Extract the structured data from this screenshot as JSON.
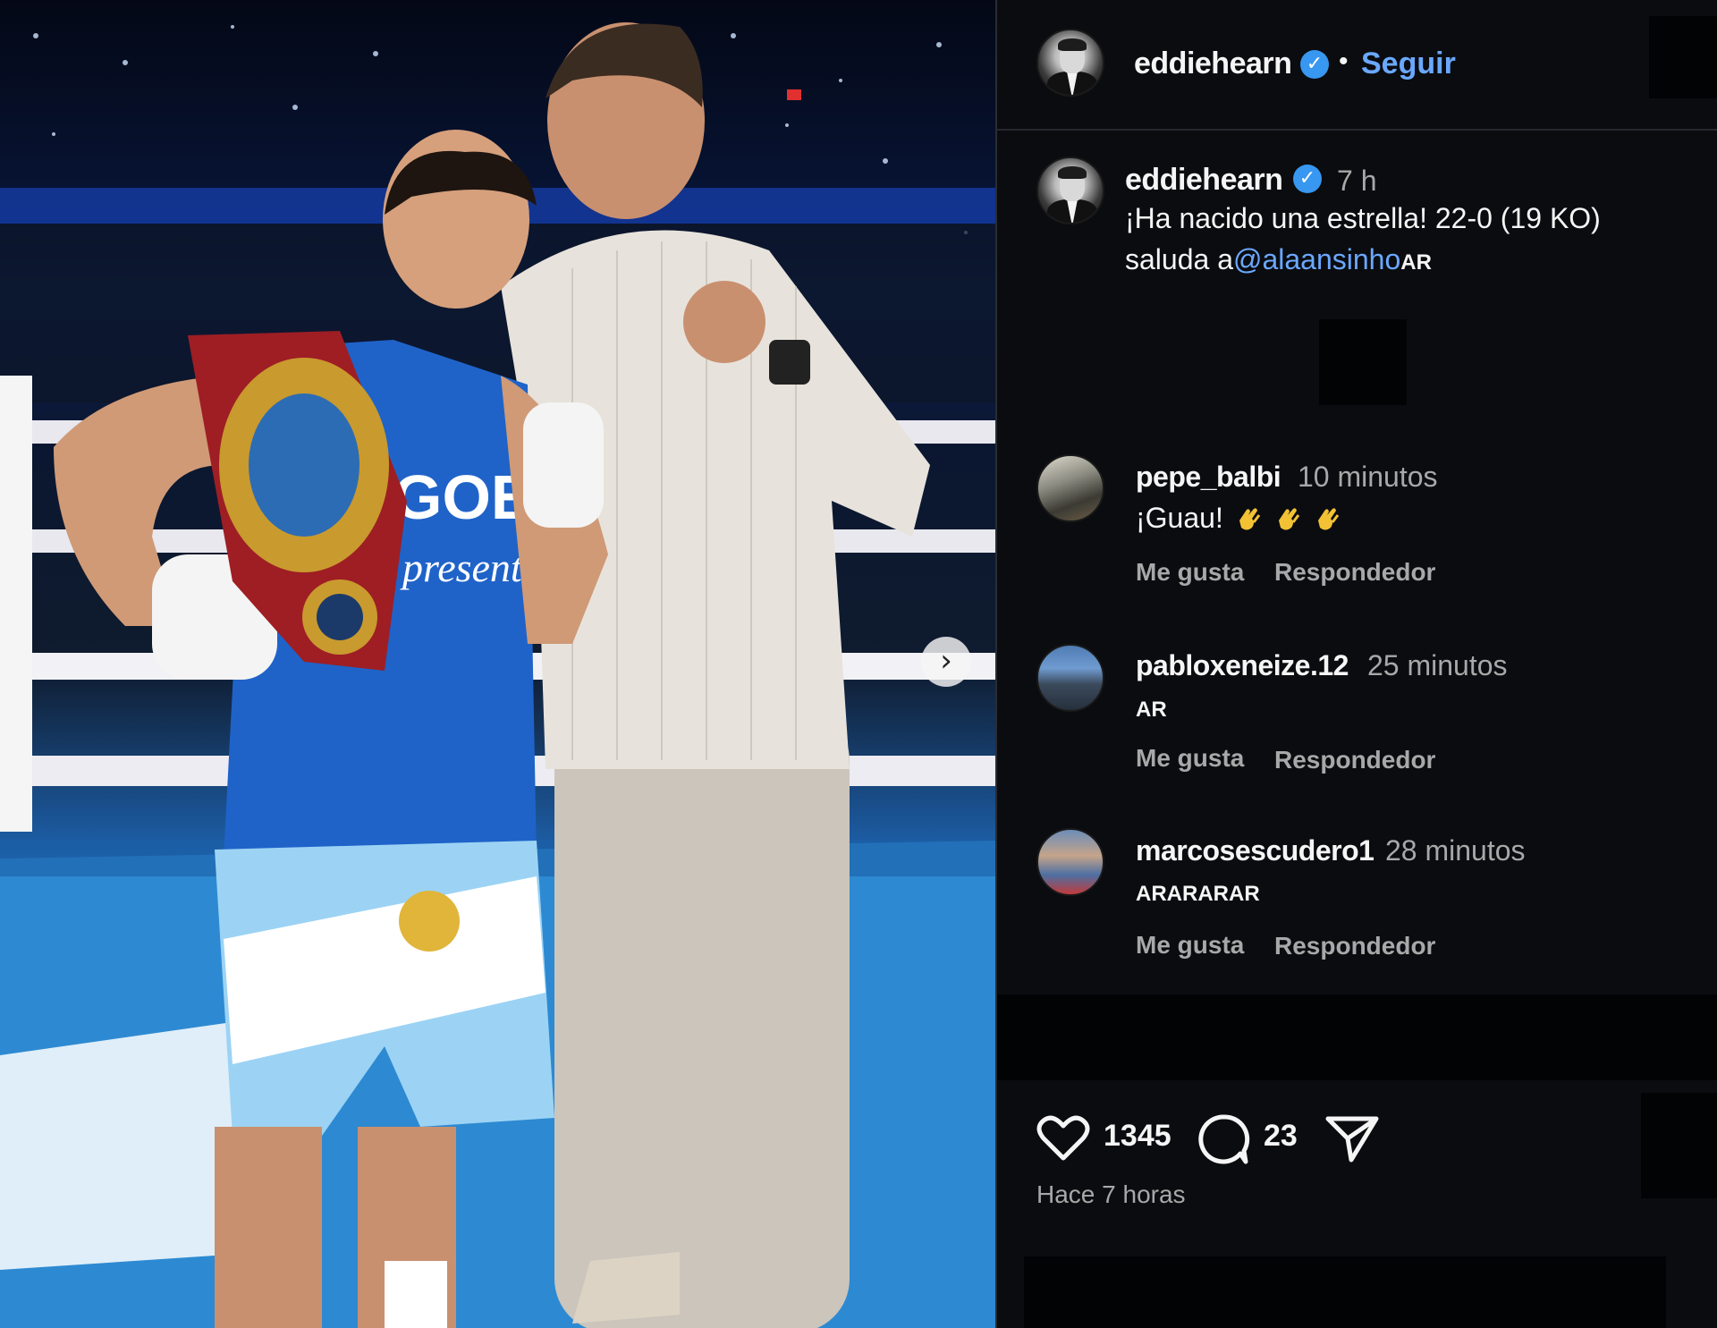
{
  "post": {
    "author": "eddiehearn",
    "follow_label": "Seguir",
    "separator": "•",
    "verified_mark": "✓"
  },
  "caption": {
    "author": "eddiehearn",
    "time": "7 h",
    "line1": "¡Ha nacido una estrella! 22-0 (19 KO)",
    "line2_prefix": "saluda a",
    "mention": "@alaansinho",
    "suffix": "AR"
  },
  "comments": [
    {
      "user": "pepe_balbi",
      "time": "10 minutos",
      "text": "¡Guau!",
      "emoji": "clapping-hands",
      "like_label": "Me gusta",
      "reply_label": "Respondedor"
    },
    {
      "user": "pabloxeneize.12",
      "time": "25 minutos",
      "text": "AR",
      "like_label": "Me gusta",
      "reply_label": "Respondedor"
    },
    {
      "user": "marcosescudero1",
      "time": "28 minutos",
      "text": "ARARARAR",
      "like_label": "Me gusta",
      "reply_label": "Respondedor"
    }
  ],
  "actions": {
    "likes": "1345",
    "comments": "23",
    "posted_ago": "Hace 7 horas",
    "icons": [
      "heart-icon",
      "comment-icon",
      "share-icon"
    ]
  },
  "colors": {
    "background": "#0b0c10",
    "link": "#6aa8ff",
    "verified": "#3897f0",
    "muted": "#a8a8a8"
  }
}
